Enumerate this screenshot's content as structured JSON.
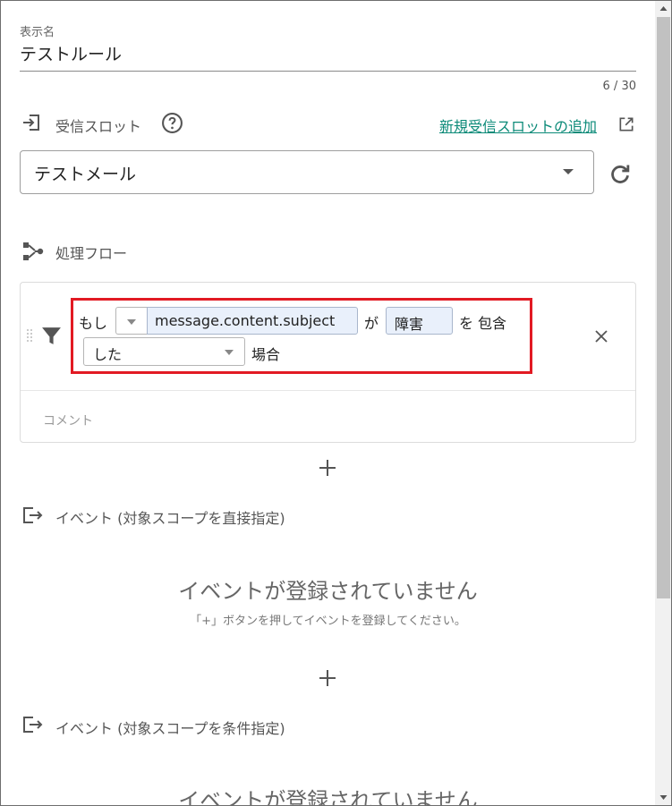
{
  "display_name": {
    "label": "表示名",
    "value": "テストルール",
    "counter": "6 / 30"
  },
  "receive_slot": {
    "label": "受信スロット",
    "help_icon": "help-circle-icon",
    "add_link": "新規受信スロットの追加",
    "selected": "テストメール"
  },
  "flow": {
    "label": "処理フロー",
    "condition": {
      "if_label": "もし",
      "field": "message.content.subject",
      "particle_ga": "が",
      "value": "障害",
      "particle_wo": "を",
      "operator": "包含",
      "tense": "した",
      "case_label": "場合"
    },
    "comment_placeholder": "コメント"
  },
  "events_direct": {
    "label": "イベント (対象スコープを直接指定)",
    "empty_title": "イベントが登録されていません",
    "empty_sub": "「+」ボタンを押してイベントを登録してください。"
  },
  "events_condition": {
    "label": "イベント (対象スコープを条件指定)",
    "empty_title": "イベントが登録されていません"
  },
  "colors": {
    "accent_link": "#0b8a78",
    "highlight": "#e21a23",
    "input_bg": "#e9f0fb"
  }
}
